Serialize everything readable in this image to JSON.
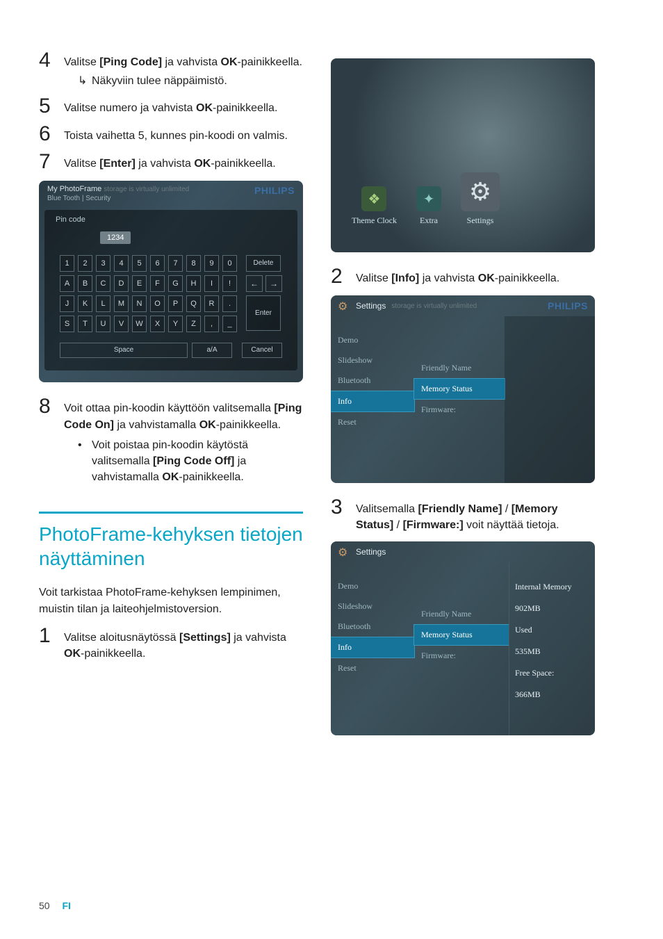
{
  "steps_left": {
    "s4": {
      "text1": "Valitse ",
      "bold1": "[Ping Code]",
      "text2": " ja vahvista ",
      "bold2": "OK",
      "text3": "-painikkeella.",
      "sub": "Näkyviin tulee näppäimistö."
    },
    "s5": {
      "text1": "Valitse numero ja vahvista ",
      "bold1": "OK",
      "text2": "-painikkeella."
    },
    "s6": {
      "text1": "Toista vaihetta 5, kunnes pin-koodi on valmis."
    },
    "s7": {
      "text1": "Valitse ",
      "bold1": "[Enter]",
      "text2": " ja vahvista ",
      "bold2": "OK",
      "text3": "-painikkeella."
    },
    "s8": {
      "text1": "Voit ottaa pin-koodin käyttöön valitsemalla ",
      "bold1": "[Ping Code On]",
      "text2": " ja vahvistamalla ",
      "bold2": "OK",
      "text3": "-painikkeella.",
      "bullet_t1": "Voit poistaa pin-koodin käytöstä valitsemalla ",
      "bullet_b1": "[Ping Code Off]",
      "bullet_t2": " ja vahvistamalla ",
      "bullet_b2": "OK",
      "bullet_t3": "-painikkeella."
    }
  },
  "section": {
    "title": "PhotoFrame-kehyksen tietojen näyttäminen",
    "intro": "Voit tarkistaa PhotoFrame-kehyksen lempinimen, muistin tilan ja laiteohjelmistoversion.",
    "s1": {
      "text1": "Valitse aloitusnäytössä ",
      "bold1": "[Settings]",
      "text2": " ja vahvista ",
      "bold2": "OK",
      "text3": "-painikkeella."
    }
  },
  "right": {
    "s2": {
      "text1": "Valitse ",
      "bold1": "[Info]",
      "text2": " ja vahvista ",
      "bold2": "OK",
      "text3": "-painikkeella."
    },
    "s3": {
      "text1": "Valitsemalla ",
      "bold1": "[Friendly Name]",
      "sep1": " / ",
      "bold2": "[Memory Status]",
      "sep2": " / ",
      "bold3": "[Firmware:]",
      "text2": " voit näyttää tietoja."
    }
  },
  "shot1": {
    "title": "My PhotoFrame",
    "subtitle_ghost": "storage is virtually unlimited",
    "crumb": "Blue Tooth | Security",
    "brand": "PHILIPS",
    "pin_label": "Pin code",
    "pin_value": "1234",
    "rows": [
      [
        "1",
        "2",
        "3",
        "4",
        "5",
        "6",
        "7",
        "8",
        "9",
        "0"
      ],
      [
        "A",
        "B",
        "C",
        "D",
        "E",
        "F",
        "G",
        "H",
        "I",
        "!"
      ],
      [
        "J",
        "K",
        "L",
        "M",
        "N",
        "O",
        "P",
        "Q",
        "R",
        "."
      ],
      [
        "S",
        "T",
        "U",
        "V",
        "W",
        "X",
        "Y",
        "Z",
        ",",
        "_"
      ]
    ],
    "delete": "Delete",
    "enter": "Enter",
    "space": "Space",
    "aa": "a/A",
    "cancel": "Cancel",
    "arrow_left": "←",
    "arrow_right": "→"
  },
  "shot2": {
    "items": [
      {
        "label": "Theme Clock"
      },
      {
        "label": "Extra"
      },
      {
        "label": "Settings"
      }
    ]
  },
  "shot3": {
    "header_title": "Settings",
    "header_ghost": "storage is virtually unlimited",
    "brand": "PHILIPS",
    "left": [
      "Demo",
      "Slideshow",
      "Bluetooth",
      "Info",
      "Reset"
    ],
    "left_active": "Info",
    "mid": [
      "Friendly Name",
      "Memory Status",
      "Firmware:"
    ],
    "mid_active": "Memory Status"
  },
  "shot4": {
    "header_title": "Settings",
    "left": [
      "Demo",
      "Slideshow",
      "Bluetooth",
      "Info",
      "Reset"
    ],
    "left_active": "Info",
    "mid": [
      "Friendly Name",
      "Memory Status",
      "Firmware:"
    ],
    "mid_active": "Memory Status",
    "right": [
      "Internal Memory",
      "902MB",
      "Used",
      "535MB",
      "Free Space:",
      "366MB"
    ]
  },
  "footer": {
    "page": "50",
    "lang": "FI"
  }
}
